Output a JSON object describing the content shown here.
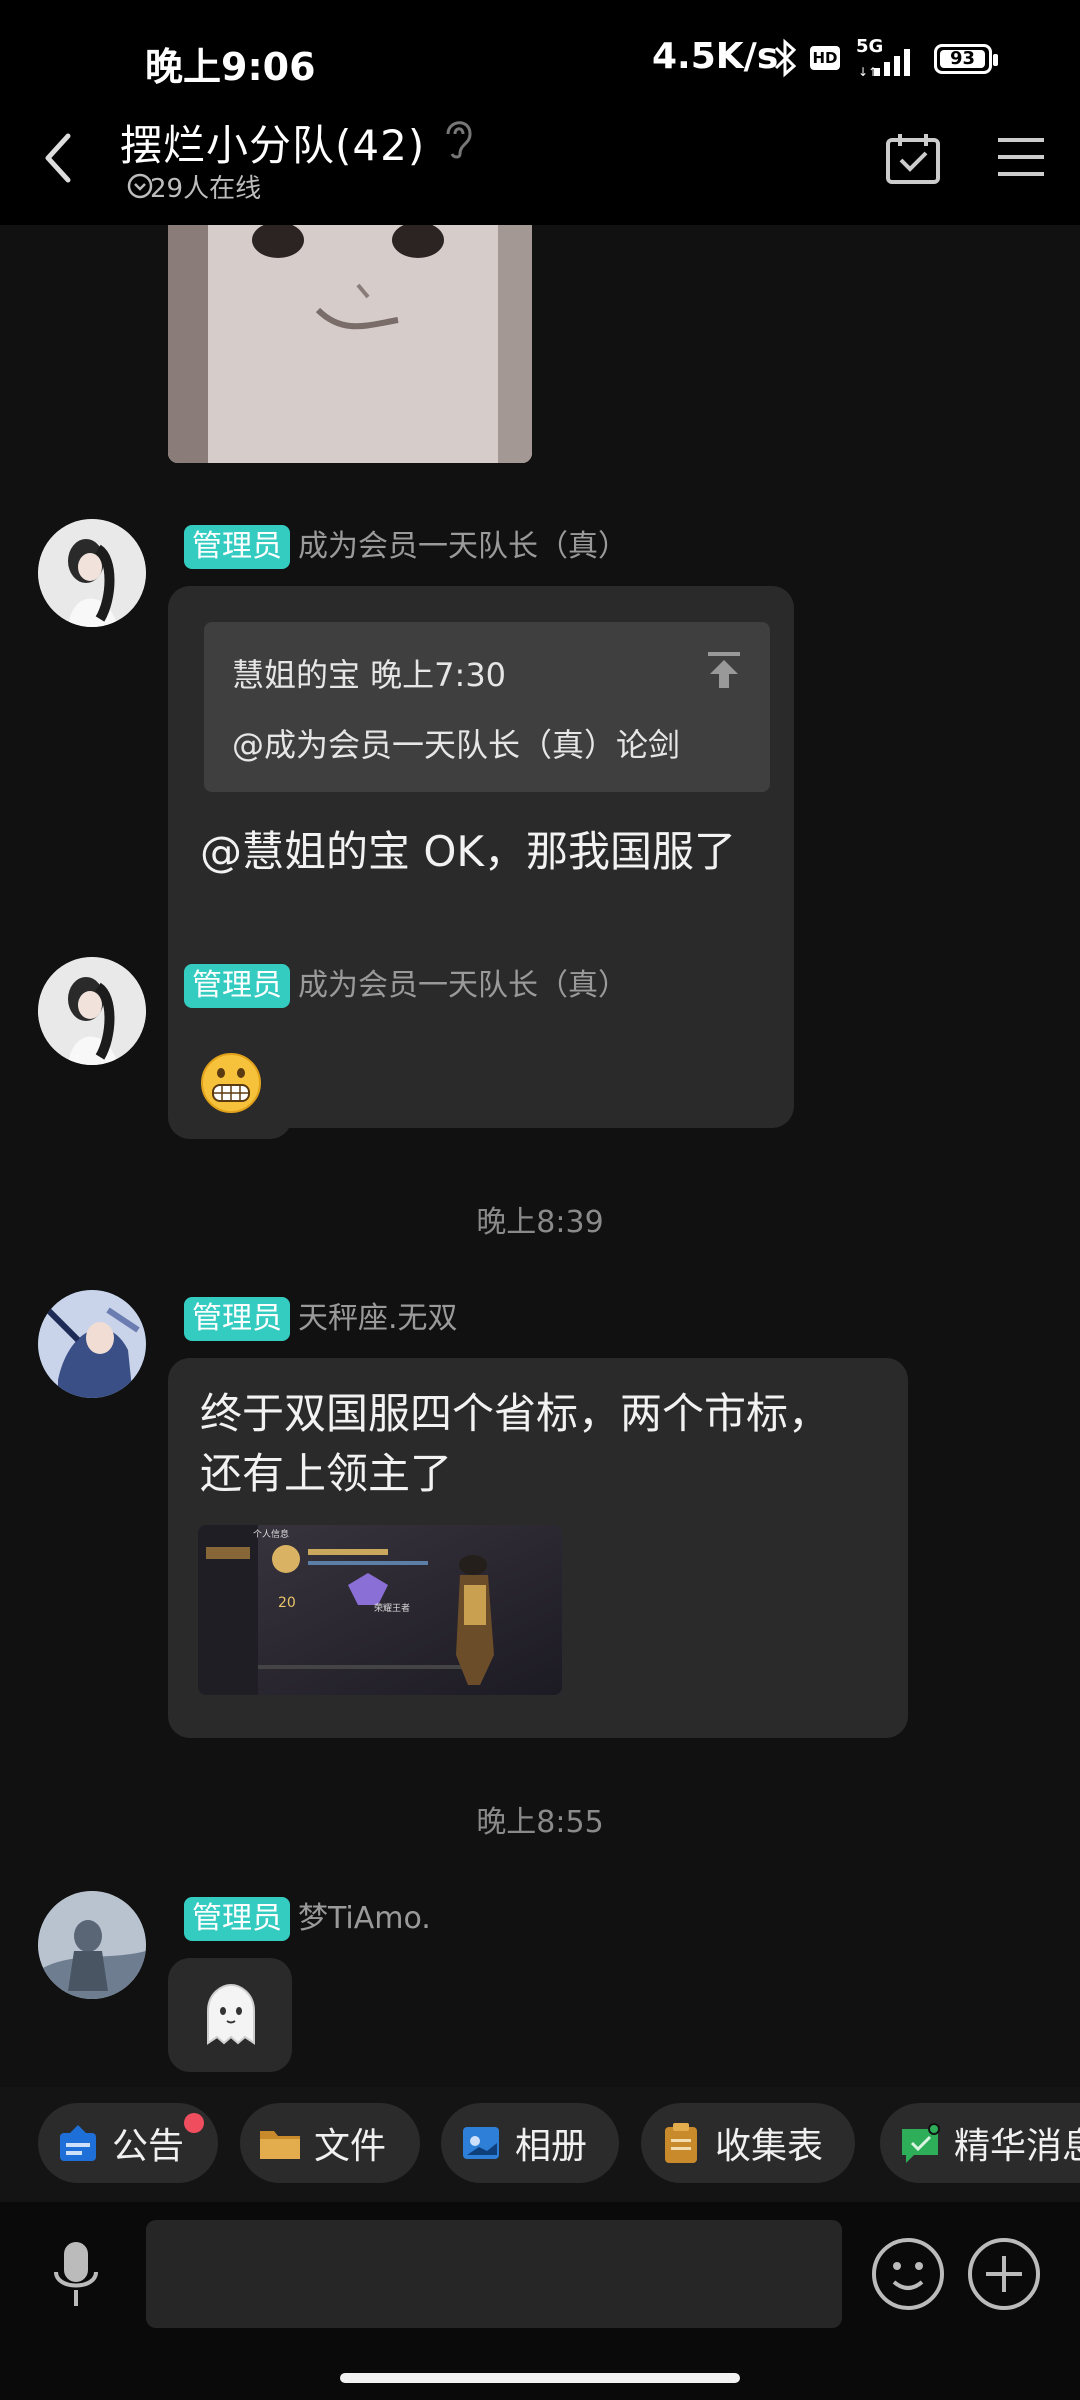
{
  "status_bar": {
    "time": "晚上9:06",
    "net_speed": "4.5K/s",
    "network": "5G",
    "hd": "HD",
    "battery": "93"
  },
  "header": {
    "title": "摆烂小分队(42)",
    "online": "29人在线"
  },
  "messages": [
    {
      "badge": "管理员",
      "sender": "成为会员一天队长（真）",
      "quote": {
        "author_time": "慧姐的宝  晚上7:30",
        "text": "@成为会员一天队长（真）论剑"
      },
      "text": "@慧姐的宝 OK，那我国服了"
    },
    {
      "badge": "管理员",
      "sender": "成为会员一天队长（真）",
      "emoji": "grimacing-face"
    },
    {
      "timestamp": "晚上8:39"
    },
    {
      "badge": "管理员",
      "sender": "天秤座.无双",
      "text_line1": "终于双国服四个省标，两个市标，",
      "text_line2": "还有上领主了",
      "image_texts": {
        "tab1": "个人信息",
        "score": "20",
        "rank": "荣耀王者"
      }
    },
    {
      "timestamp": "晚上8:55"
    },
    {
      "badge": "管理员",
      "sender": "梦TiAmo.",
      "emoji": "ghost"
    }
  ],
  "toolbar": {
    "items": [
      {
        "label": "公告",
        "icon": "announcement-icon",
        "color": "#1f6fd8",
        "has_dot": true
      },
      {
        "label": "文件",
        "icon": "folder-icon",
        "color": "#d9a441"
      },
      {
        "label": "相册",
        "icon": "album-icon",
        "color": "#2d7fd8"
      },
      {
        "label": "收集表",
        "icon": "clipboard-icon",
        "color": "#c98a2b"
      },
      {
        "label": "精华消息",
        "icon": "highlight-icon",
        "color": "#2fae5a"
      }
    ]
  },
  "input": {
    "placeholder": ""
  },
  "colors": {
    "accent_badge": "#34cbc0",
    "bubble": "#2a2a2a",
    "background": "#111111"
  }
}
